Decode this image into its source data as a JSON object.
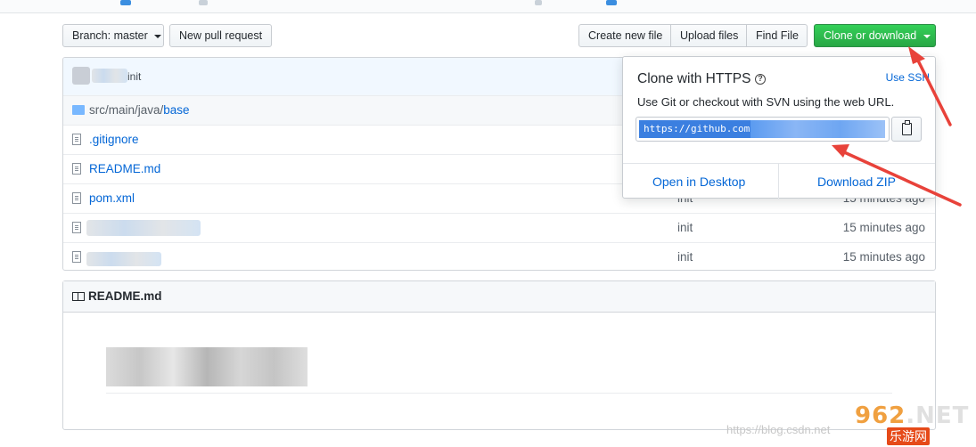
{
  "toolbar": {
    "branch_label": "Branch:",
    "branch_value": "master",
    "new_pull_request": "New pull request",
    "create_new_file": "Create new file",
    "upload_files": "Upload files",
    "find_file": "Find File",
    "clone_or_download": "Clone or download"
  },
  "commit": {
    "message": "init"
  },
  "files": [
    {
      "name": "src/main/java/base",
      "path_prefix": "src/main/java/",
      "path_last": "base",
      "type": "dir",
      "message": "",
      "age": ""
    },
    {
      "name": ".gitignore",
      "type": "file",
      "message": "",
      "age": ""
    },
    {
      "name": "README.md",
      "type": "file",
      "message": "",
      "age": ""
    },
    {
      "name": "pom.xml",
      "type": "file",
      "message": "init",
      "age": "15 minutes ago"
    },
    {
      "name": "",
      "type": "file",
      "message": "init",
      "age": "15 minutes ago"
    },
    {
      "name": "",
      "type": "file",
      "message": "init",
      "age": "15 minutes ago"
    }
  ],
  "readme": {
    "title": "README.md"
  },
  "clone_popover": {
    "title": "Clone with HTTPS",
    "use_ssh": "Use SSH",
    "description": "Use Git or checkout with SVN using the web URL.",
    "url_visible": "https://github.com",
    "open_in_desktop": "Open in Desktop",
    "download_zip": "Download ZIP"
  },
  "watermark": {
    "text": "https://blog.csdn.net",
    "logo_main": "962",
    "logo_suffix": ".NET",
    "logo_sub": "乐游网"
  },
  "colors": {
    "accent_green": "#28a745",
    "link_blue": "#0366d6",
    "annotation_red": "#e8423a"
  }
}
